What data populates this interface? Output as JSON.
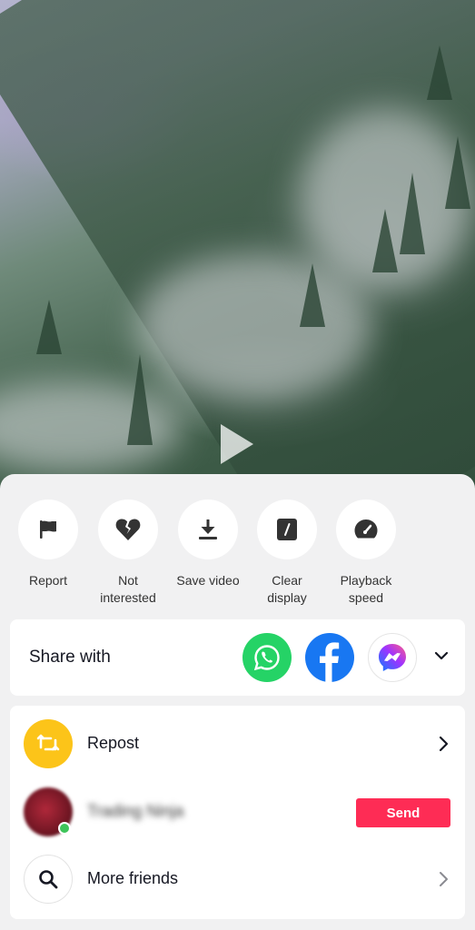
{
  "video": {
    "play_icon": "play-icon"
  },
  "actions": [
    {
      "label": "Report",
      "icon": "flag-icon"
    },
    {
      "label": "Not\ninterested",
      "icon": "broken-heart-icon"
    },
    {
      "label": "Save video",
      "icon": "download-icon"
    },
    {
      "label": "Clear\ndisplay",
      "icon": "clear-display-icon"
    },
    {
      "label": "Playback\nspeed",
      "icon": "speedometer-icon"
    }
  ],
  "share": {
    "title": "Share with",
    "apps": [
      {
        "name": "WhatsApp",
        "icon": "whatsapp-icon",
        "color": "#25d366"
      },
      {
        "name": "Facebook",
        "icon": "facebook-icon",
        "color": "#1877f2"
      },
      {
        "name": "Messenger",
        "icon": "messenger-icon",
        "color": "#a033ff"
      }
    ],
    "expand_icon": "chevron-down-icon"
  },
  "friends": {
    "repost_label": "Repost",
    "repost_color": "#fcc419",
    "friend_name": "Trading Ninja",
    "send_label": "Send",
    "send_color": "#fe2c55",
    "more_label": "More friends"
  }
}
